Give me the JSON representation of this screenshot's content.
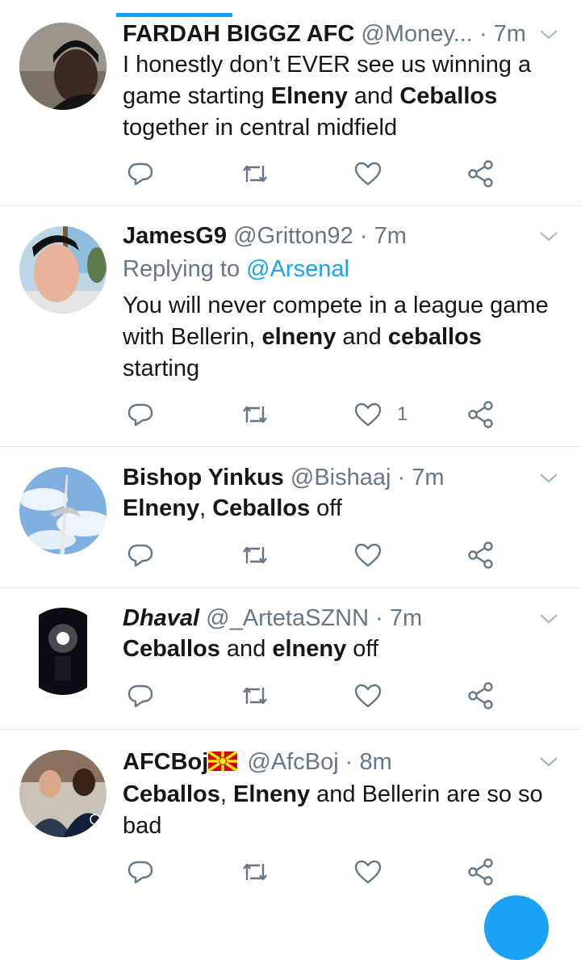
{
  "tabs": {
    "active_indicator_color": "#1da1f2"
  },
  "tweets": [
    {
      "name": "FARDAH BIGGZ AFC",
      "handle": "@Money...",
      "dot": "·",
      "time": "7m",
      "segments": [
        {
          "text": "I honestly don’t EVER see us winning a game starting ",
          "bold": false
        },
        {
          "text": "Elneny",
          "bold": true
        },
        {
          "text": " and ",
          "bold": false
        },
        {
          "text": "Ceballos",
          "bold": true
        },
        {
          "text": " together in central midfield",
          "bold": false
        }
      ],
      "likes": ""
    },
    {
      "name": "JamesG9",
      "handle": "@Gritton92",
      "dot": "·",
      "time": "7m",
      "replying_prefix": "Replying to",
      "replying_to": "@Arsenal",
      "segments": [
        {
          "text": "You will never compete in a league game with Bellerin, ",
          "bold": false
        },
        {
          "text": "elneny",
          "bold": true
        },
        {
          "text": " and ",
          "bold": false
        },
        {
          "text": "ceballos",
          "bold": true
        },
        {
          "text": " starting",
          "bold": false
        }
      ],
      "likes": "1"
    },
    {
      "name": "Bishop Yinkus",
      "handle": "@Bishaaj",
      "dot": "·",
      "time": "7m",
      "segments": [
        {
          "text": "Elneny",
          "bold": true
        },
        {
          "text": ", ",
          "bold": false
        },
        {
          "text": "Ceballos",
          "bold": true
        },
        {
          "text": " off",
          "bold": false
        }
      ],
      "likes": ""
    },
    {
      "name": "Dhaval",
      "handle": "@_ArtetaSZNN",
      "dot": "·",
      "time": "7m",
      "segments": [
        {
          "text": "Ceballos",
          "bold": true
        },
        {
          "text": " and ",
          "bold": false
        },
        {
          "text": "elneny",
          "bold": true
        },
        {
          "text": " off",
          "bold": false
        }
      ],
      "likes": ""
    },
    {
      "name": "AFCBoj",
      "handle": "@AfcBoj",
      "dot": "·",
      "time": "8m",
      "flag_emoji": "macedonia-flag",
      "segments": [
        {
          "text": "Ceballos",
          "bold": true
        },
        {
          "text": ", ",
          "bold": false
        },
        {
          "text": "Elneny",
          "bold": true
        },
        {
          "text": " and Bellerin are so so bad",
          "bold": false
        }
      ],
      "likes": ""
    }
  ],
  "icons": [
    "reply-icon",
    "retweet-icon",
    "like-icon",
    "share-icon",
    "chevron-down-icon"
  ],
  "colors": {
    "accent": "#1da1f2",
    "secondary_text": "#657786",
    "divider": "#e1e8ed"
  }
}
